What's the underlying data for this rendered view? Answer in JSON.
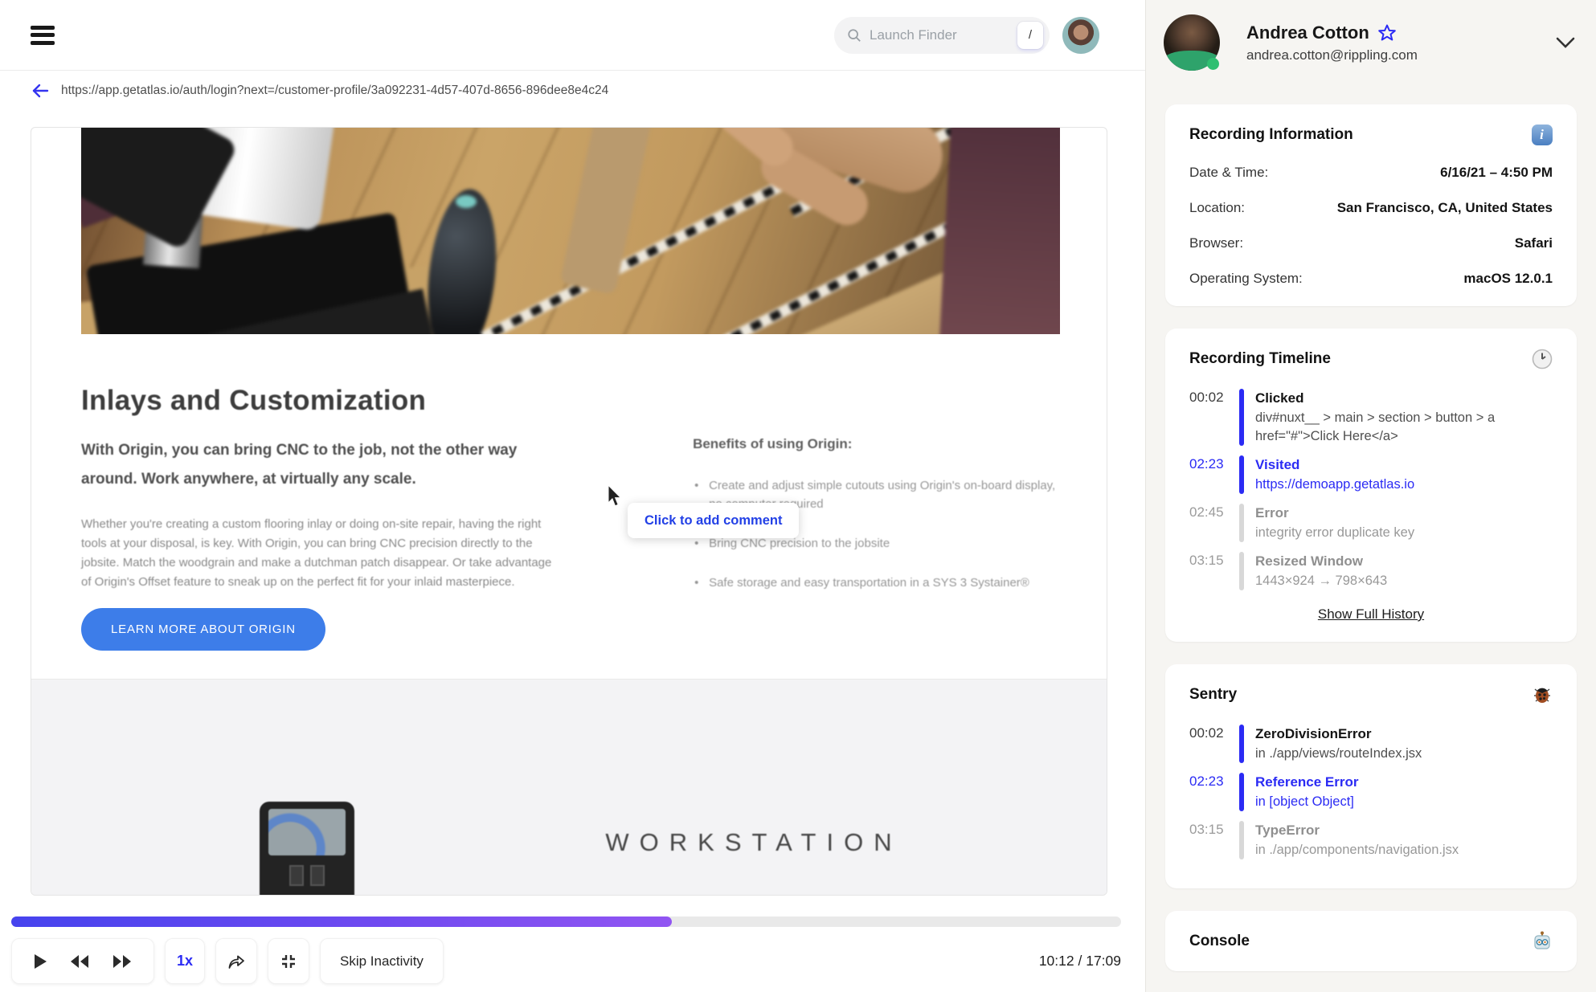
{
  "topbar": {
    "search_placeholder": "Launch Finder",
    "search_shortcut": "/"
  },
  "urlbar": {
    "url": "https://app.getatlas.io/auth/login?next=/customer-profile/3a092231-4d57-407d-8656-896dee8e4c24"
  },
  "video": {
    "heading": "Inlays and Customization",
    "lead": "With Origin, you can bring CNC to the job, not the other way around. Work anywhere, at virtually any scale.",
    "body": "Whether you're creating a custom flooring inlay or doing on-site repair, having the right tools at your disposal, is key. With Origin, you can bring CNC precision directly to the jobsite. Match the woodgrain and make a dutchman patch disappear. Or take advantage of Origin's Offset feature to sneak up on the perfect fit for your inlaid masterpiece.",
    "benefits_title": "Benefits of using Origin:",
    "benefits": [
      "Create and adjust simple cutouts using Origin's on-board display, no computer required",
      "Bring CNC precision to the jobsite",
      "Safe storage and easy transportation in a SYS 3 Systainer®"
    ],
    "cta_label": "LEARN MORE ABOUT ORIGIN",
    "workstation_logo": "WORKSTATION",
    "comment_tooltip": "Click to add comment"
  },
  "player": {
    "progress_percent": 59.5,
    "speed_label": "1x",
    "skip_inactivity_label": "Skip Inactivity",
    "time_display": "10:12 / 17:09",
    "progress_colors": {
      "start": "#4643ee",
      "end": "#9155f2"
    }
  },
  "sidebar": {
    "user": {
      "name": "Andrea Cotton",
      "email": "andrea.cotton@rippling.com"
    },
    "recording_information": {
      "title": "Recording Information",
      "icon": "info-icon",
      "rows": [
        {
          "label": "Date & Time:",
          "value": "6/16/21 – 4:50 PM"
        },
        {
          "label": "Location:",
          "value": "San Francisco, CA, United States"
        },
        {
          "label": "Browser:",
          "value": "Safari"
        },
        {
          "label": "Operating System:",
          "value": "macOS 12.0.1"
        }
      ]
    },
    "recording_timeline": {
      "title": "Recording Timeline",
      "icon": "clock-icon",
      "entries": [
        {
          "time": "00:02",
          "title": "Clicked",
          "detail": "div#nuxt__ > main > section > button > a href=\"#\">Click Here</a>",
          "status": "done"
        },
        {
          "time": "02:23",
          "title": "Visited",
          "detail": "https://demoapp.getatlas.io",
          "status": "active"
        },
        {
          "time": "02:45",
          "title": "Error",
          "detail": "integrity error duplicate key",
          "status": "upcoming"
        },
        {
          "time": "03:15",
          "title": "Resized Window",
          "detail": "1443×924 → 798×643",
          "status": "upcoming"
        }
      ],
      "footer_link": "Show Full History"
    },
    "sentry": {
      "title": "Sentry",
      "icon": "bug-icon",
      "entries": [
        {
          "time": "00:02",
          "title": "ZeroDivisionError",
          "detail": "in ./app/views/routeIndex.jsx",
          "status": "done"
        },
        {
          "time": "02:23",
          "title": "Reference Error",
          "detail": "in [object Object]",
          "status": "active"
        },
        {
          "time": "03:15",
          "title": "TypeError",
          "detail": "in ./app/components/navigation.jsx",
          "status": "upcoming"
        }
      ]
    },
    "console": {
      "title": "Console",
      "icon": "robot-icon"
    }
  },
  "colors": {
    "accent_blue": "#2b2bf4",
    "cta_blue": "#3d7de9"
  }
}
